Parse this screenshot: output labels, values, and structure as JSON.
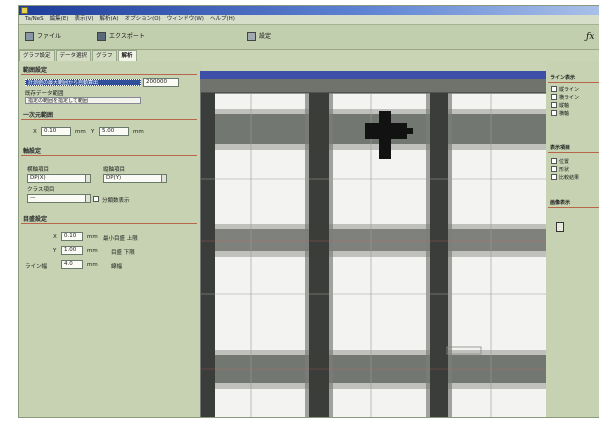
{
  "titlebar": {
    "title": ""
  },
  "menu": {
    "items": [
      "Ta/NeS",
      "編集(E)",
      "表示(V)",
      "解析(A)",
      "オプション(O)",
      "ウィンドウ(W)",
      "ヘルプ(H)"
    ]
  },
  "toolbar": {
    "btn1": "ファイル",
    "btn2": "エクスポート",
    "btn3": "設定",
    "fx": "ƒx"
  },
  "tabs": [
    "グラフ設定",
    "データ選択",
    "グラフ",
    "解析"
  ],
  "left": {
    "sec_range": "範囲設定",
    "select1": "計測値の最大範囲から自動算出",
    "select1_value": "200000",
    "opt2": "既存データ範囲",
    "opt3": "指定の範囲を指定して範囲",
    "sec_one": "一次元範囲",
    "x_from": "0.10",
    "x_unit": "mm",
    "x_to": "5.00",
    "x_unit2": "mm",
    "sec_axis": "軸設定",
    "h_label": "横軸項目",
    "v_label": "縦軸項目",
    "h_value": "DP(X)",
    "v_value": "DP(Y)",
    "class_label": "クラス項目",
    "class_value": "—",
    "check_label": "分類数表示",
    "sec_scale": "目盛設定",
    "row1_value": "0.10",
    "row1_unit": "mm",
    "row1_note": "最小目盛 上限",
    "row2_value": "1.00",
    "row2_unit": "mm",
    "row2_note": "目盛 下限",
    "row3_label": "ライン幅",
    "row3_value": "4.0",
    "row3_unit": "mm",
    "row3_note": "線幅"
  },
  "right": {
    "sec1": "ライン表示",
    "items1": [
      "縦ライン",
      "横ライン",
      "縦軸",
      "横軸"
    ],
    "sec2": "表示項目",
    "items2": [
      "位置",
      "形状",
      "比較結果"
    ],
    "sec3": "画像表示"
  },
  "colors": {
    "app_bg": "#c8d4b4",
    "titlebar": "#1e3c9a",
    "accent_line": "#b8654a",
    "viewer_bar": "#3d4fa6"
  }
}
